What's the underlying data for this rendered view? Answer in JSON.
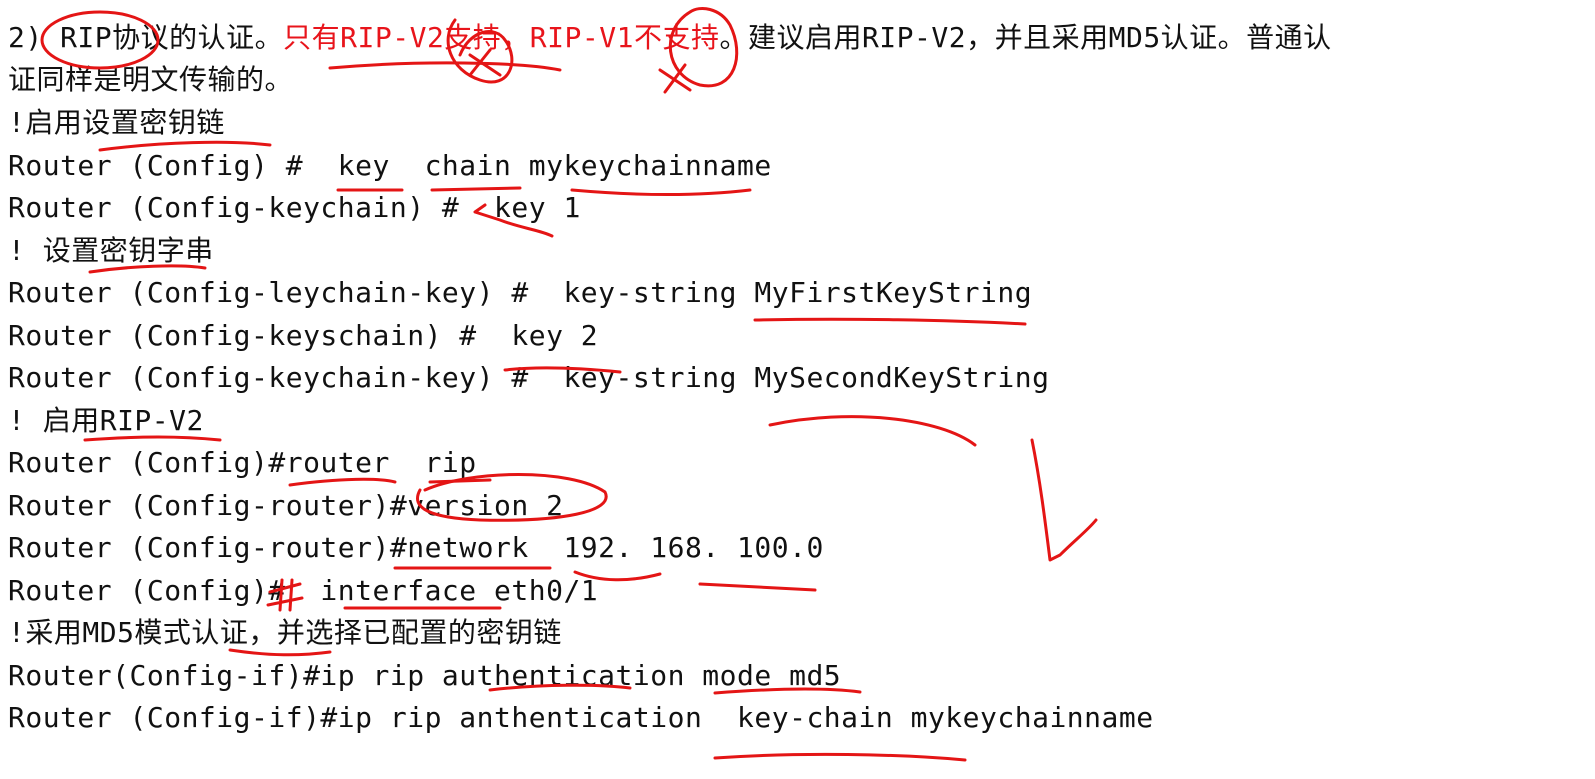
{
  "intro": {
    "number": "2)",
    "lead": " RIP协议的认证。",
    "highlight": "只有RIP-V2支持，RIP-V1不支持",
    "rest": "。建议启用RIP-V2，并且采用MD5认证。普通认",
    "cont": "证同样是明文传输的。"
  },
  "lines": [
    "!启用设置密钥链",
    "Router (Config) #  key  chain mykeychainname",
    "Router (Config-keychain) #  key 1",
    "! 设置密钥字串",
    "Router (Config-leychain-key) #  key-string MyFirstKeyString",
    "Router (Config-keyschain) #  key 2",
    "Router (Config-keychain-key) #  key-string MySecondKeyString",
    "! 启用RIP-V2",
    "Router (Config)#router  rip",
    "Router (Config-router)#version 2",
    "Router (Config-router)#network  192. 168. 100.0",
    "Router (Config)#  interface eth0/1",
    "!采用MD5模式认证，并选择已配置的密钥链",
    "Router(Config-if)#ip rip authentication mode md5",
    "Router (Config-if)#ip rip anthentication  key-chain mykeychainname"
  ],
  "colors": {
    "text": "#111111",
    "highlight": "#e8141b",
    "annotation": "#e41515",
    "background": "#ffffff"
  }
}
